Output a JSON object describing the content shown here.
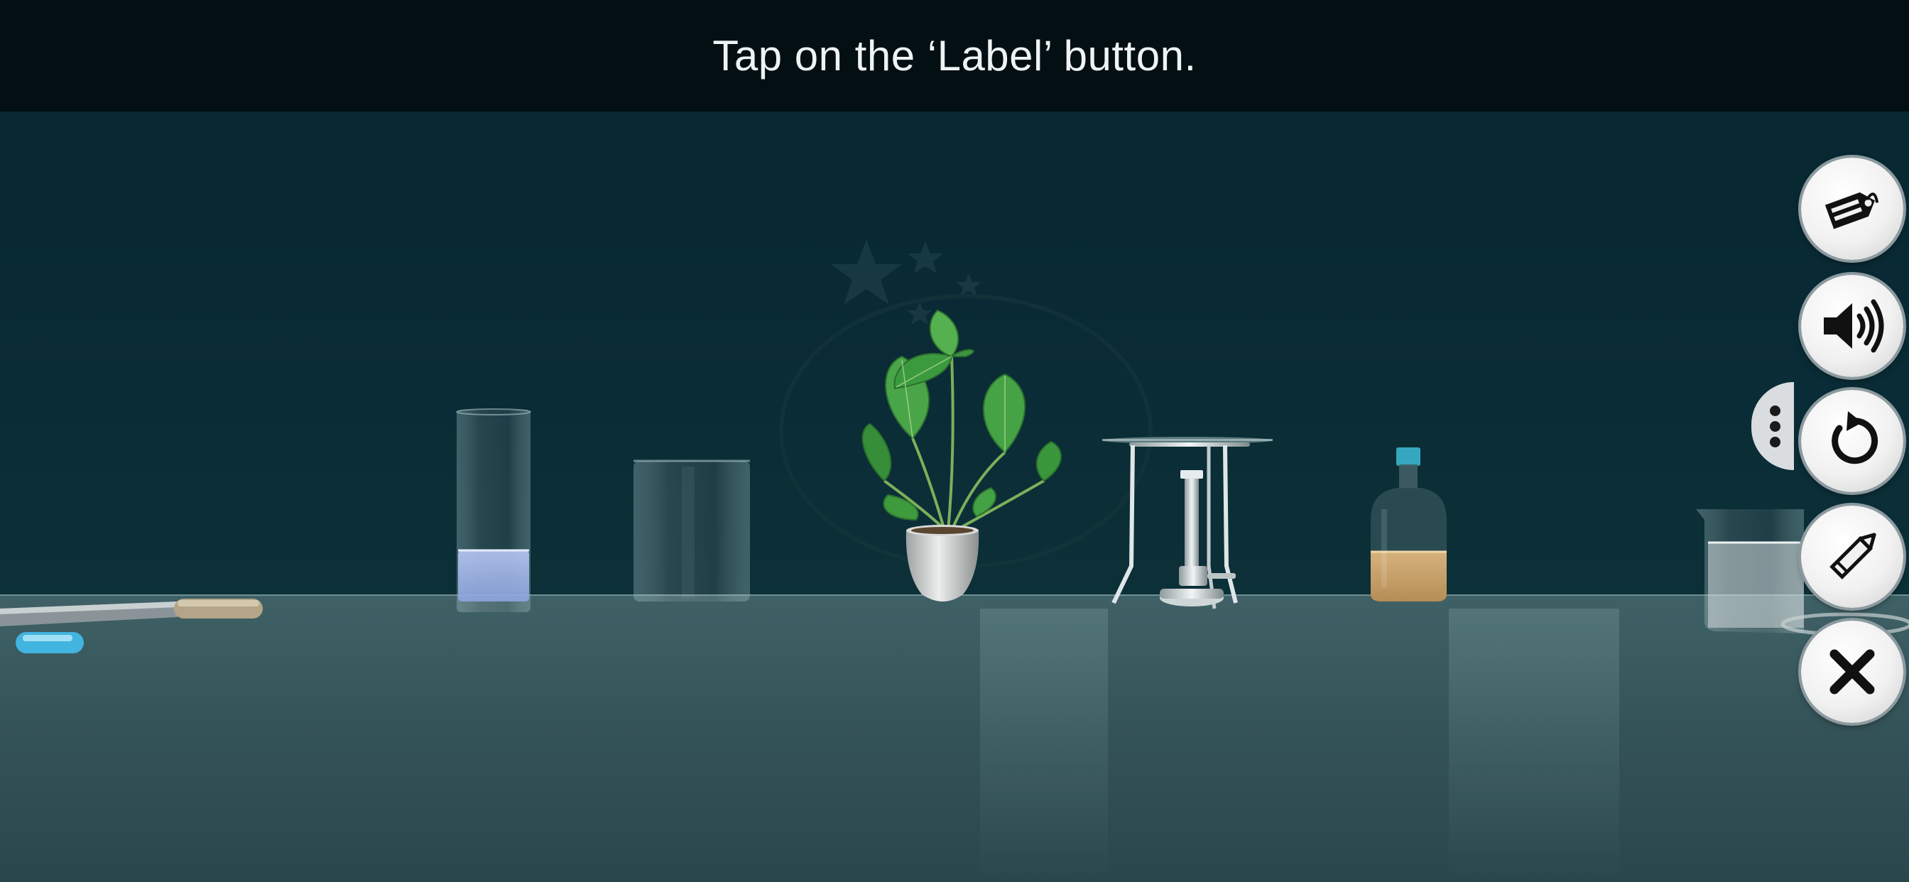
{
  "instruction": {
    "text": "Tap on the ‘Label’ button."
  },
  "toolbar": {
    "buttons": [
      {
        "id": "label",
        "icon": "label-tag-icon"
      },
      {
        "id": "sound",
        "icon": "speaker-icon"
      },
      {
        "id": "reset",
        "icon": "restart-icon"
      },
      {
        "id": "draw",
        "icon": "pencil-icon"
      },
      {
        "id": "close",
        "icon": "close-icon"
      }
    ],
    "more": {
      "icon": "more-dots-icon"
    }
  },
  "scene": {
    "objects": [
      "forceps",
      "capsule",
      "small-beaker",
      "empty-beaker",
      "potted-plant",
      "tripod-stand",
      "bunsen-burner",
      "amber-bottle",
      "large-beaker"
    ],
    "colors": {
      "background": "#06252f",
      "table": "#3a5b60",
      "instruction_bar": "#030f13",
      "button_face": "#f1f1f1"
    }
  }
}
